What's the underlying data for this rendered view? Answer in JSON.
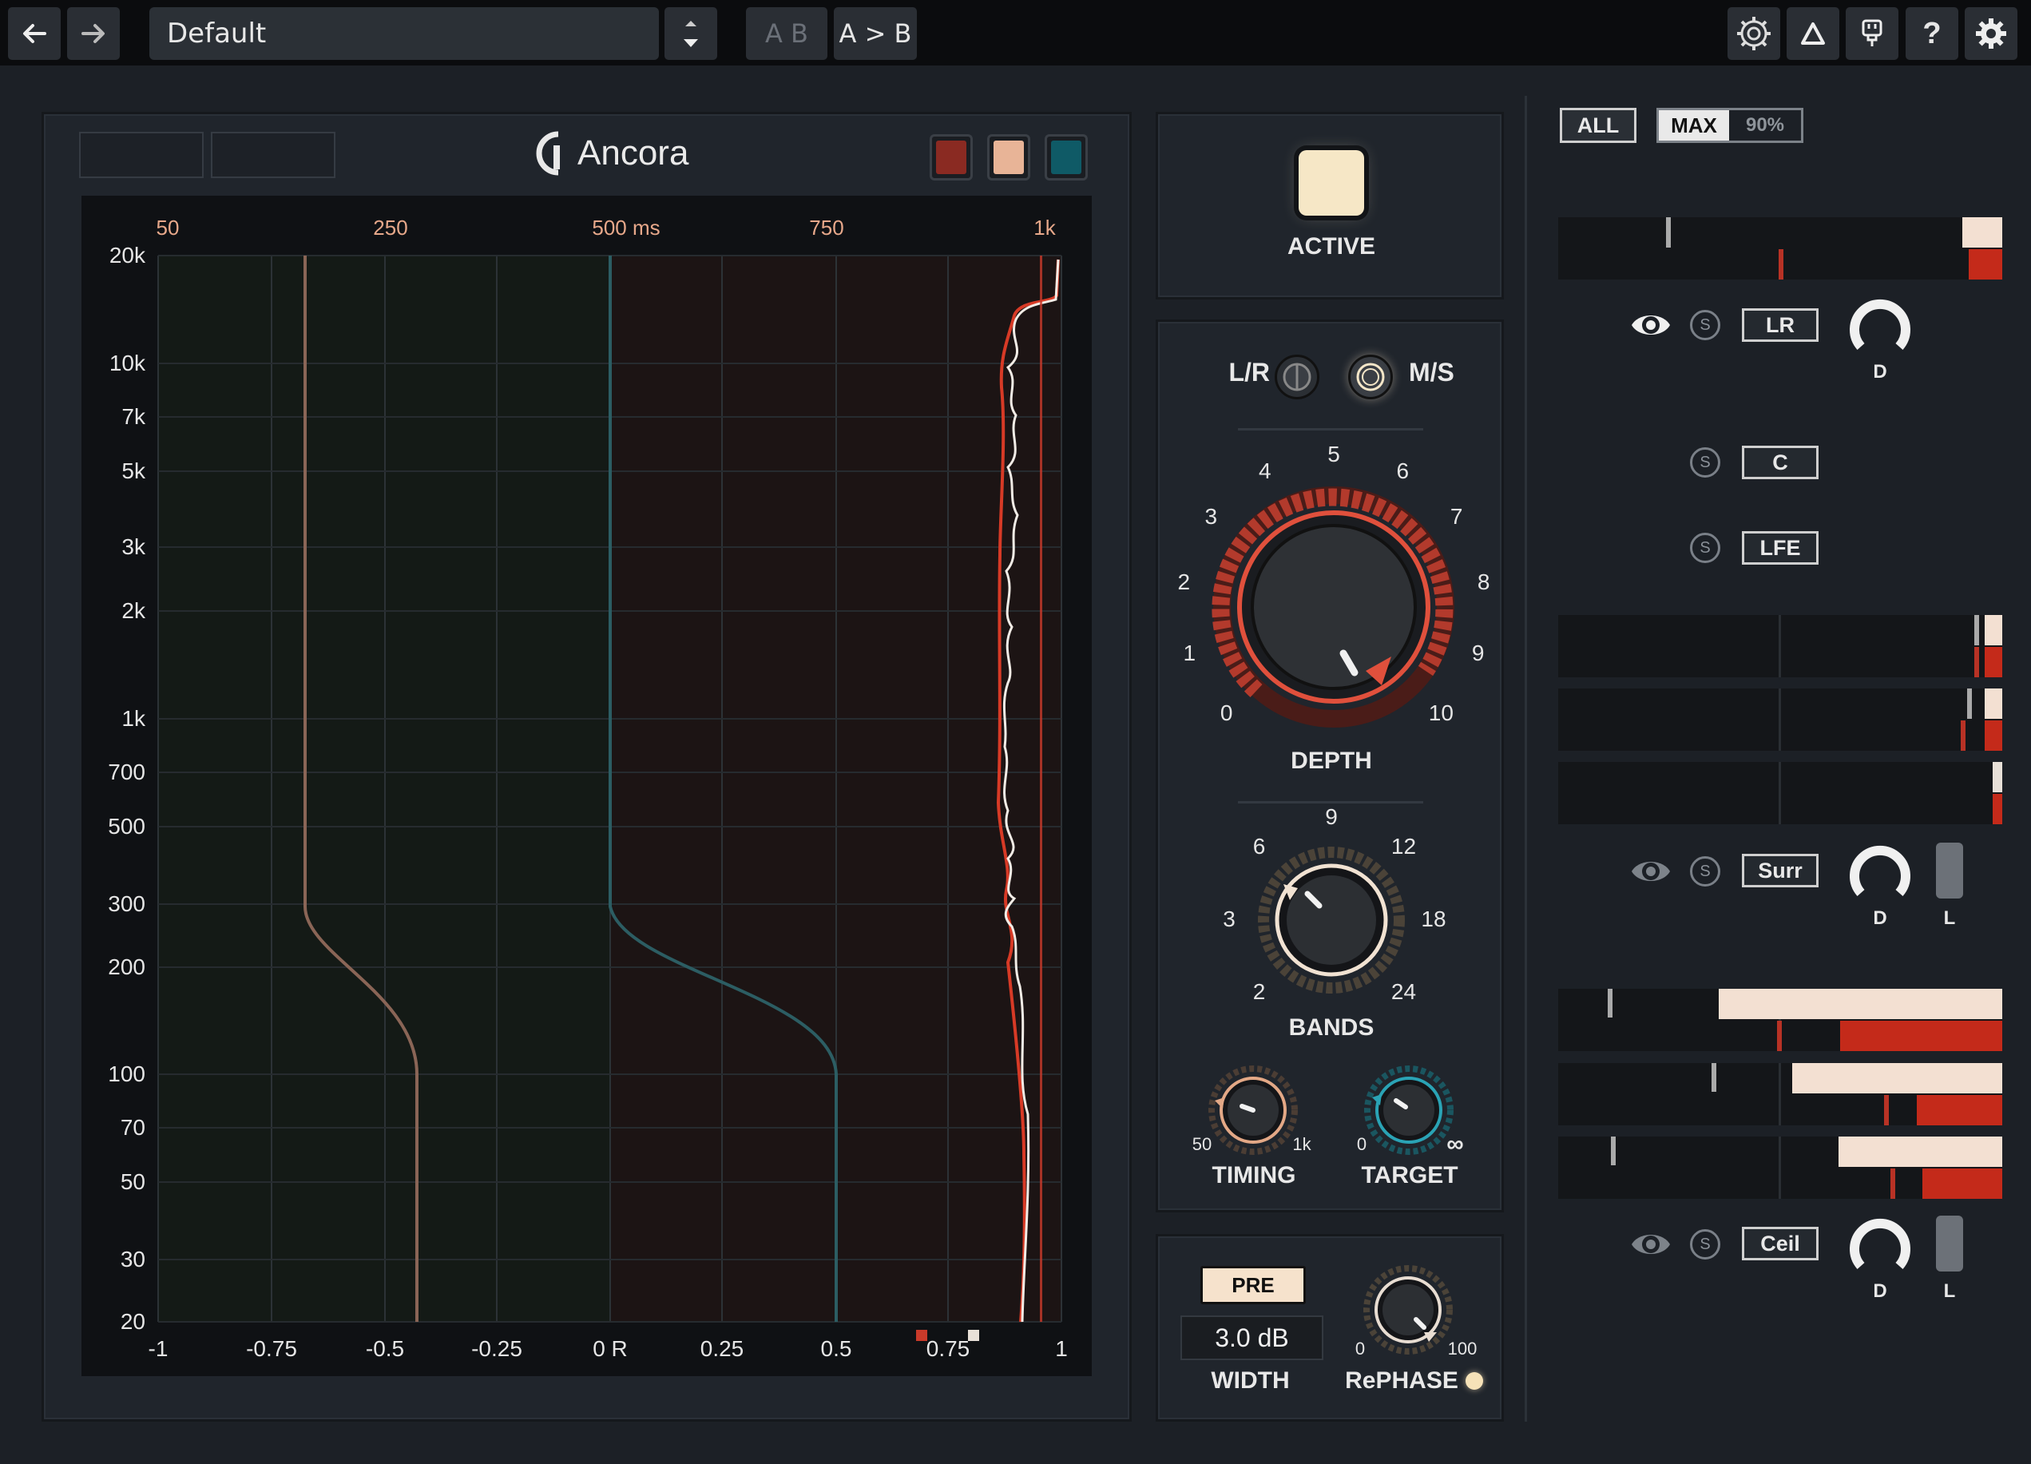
{
  "topbar": {
    "back_icon": "arrow-left-icon",
    "forward_icon": "arrow-right-icon",
    "preset_name": "Default",
    "ab_label": "A B",
    "a_to_b_label": "A > B",
    "icons": [
      "tonal-balance-icon",
      "delta-icon",
      "plug-icon",
      "help-icon",
      "settings-gear-icon"
    ],
    "help_glyph": "?"
  },
  "display": {
    "brand": "Ancora",
    "swatches": [
      "#8a2a22",
      "#e8b497",
      "#0f5a66"
    ],
    "time_ticks": [
      "50",
      "250",
      "500 ms",
      "750",
      "1k"
    ],
    "freq_ticks": [
      "20k",
      "10k",
      "7k",
      "5k",
      "3k",
      "2k",
      "1k",
      "700",
      "500",
      "300",
      "200",
      "100",
      "70",
      "50",
      "30",
      "20"
    ],
    "corr_ticks": [
      "-1",
      "-0.75",
      "-0.5",
      "-0.25",
      "0 R",
      "0.25",
      "0.5",
      "0.75",
      "1"
    ]
  },
  "active": {
    "label": "ACTIVE"
  },
  "mode": {
    "lr_label": "L/R",
    "ms_label": "M/S"
  },
  "depth": {
    "label": "DEPTH",
    "scale": [
      "0",
      "1",
      "2",
      "3",
      "4",
      "5",
      "6",
      "7",
      "8",
      "9",
      "10"
    ],
    "value": 8.3
  },
  "bands": {
    "label": "BANDS",
    "scale": [
      "2",
      "3",
      "6",
      "9",
      "12",
      "18",
      "24"
    ]
  },
  "timing": {
    "label": "TIMING",
    "min": "50",
    "max": "1k"
  },
  "target": {
    "label": "TARGET",
    "min": "0",
    "max": "∞"
  },
  "width": {
    "pre_label": "PRE",
    "value": "3.0 dB",
    "label": "WIDTH"
  },
  "rephase": {
    "label": "RePHASE",
    "min": "0",
    "max": "100"
  },
  "right": {
    "all_label": "ALL",
    "max_label": "MAX",
    "pct_label": "90%",
    "lr_label": "LR",
    "c_label": "C",
    "lfe_label": "LFE",
    "surr_label": "Surr",
    "ceil_label": "Ceil",
    "solo_glyph": "S",
    "d_label": "D",
    "l_label": "L"
  }
}
